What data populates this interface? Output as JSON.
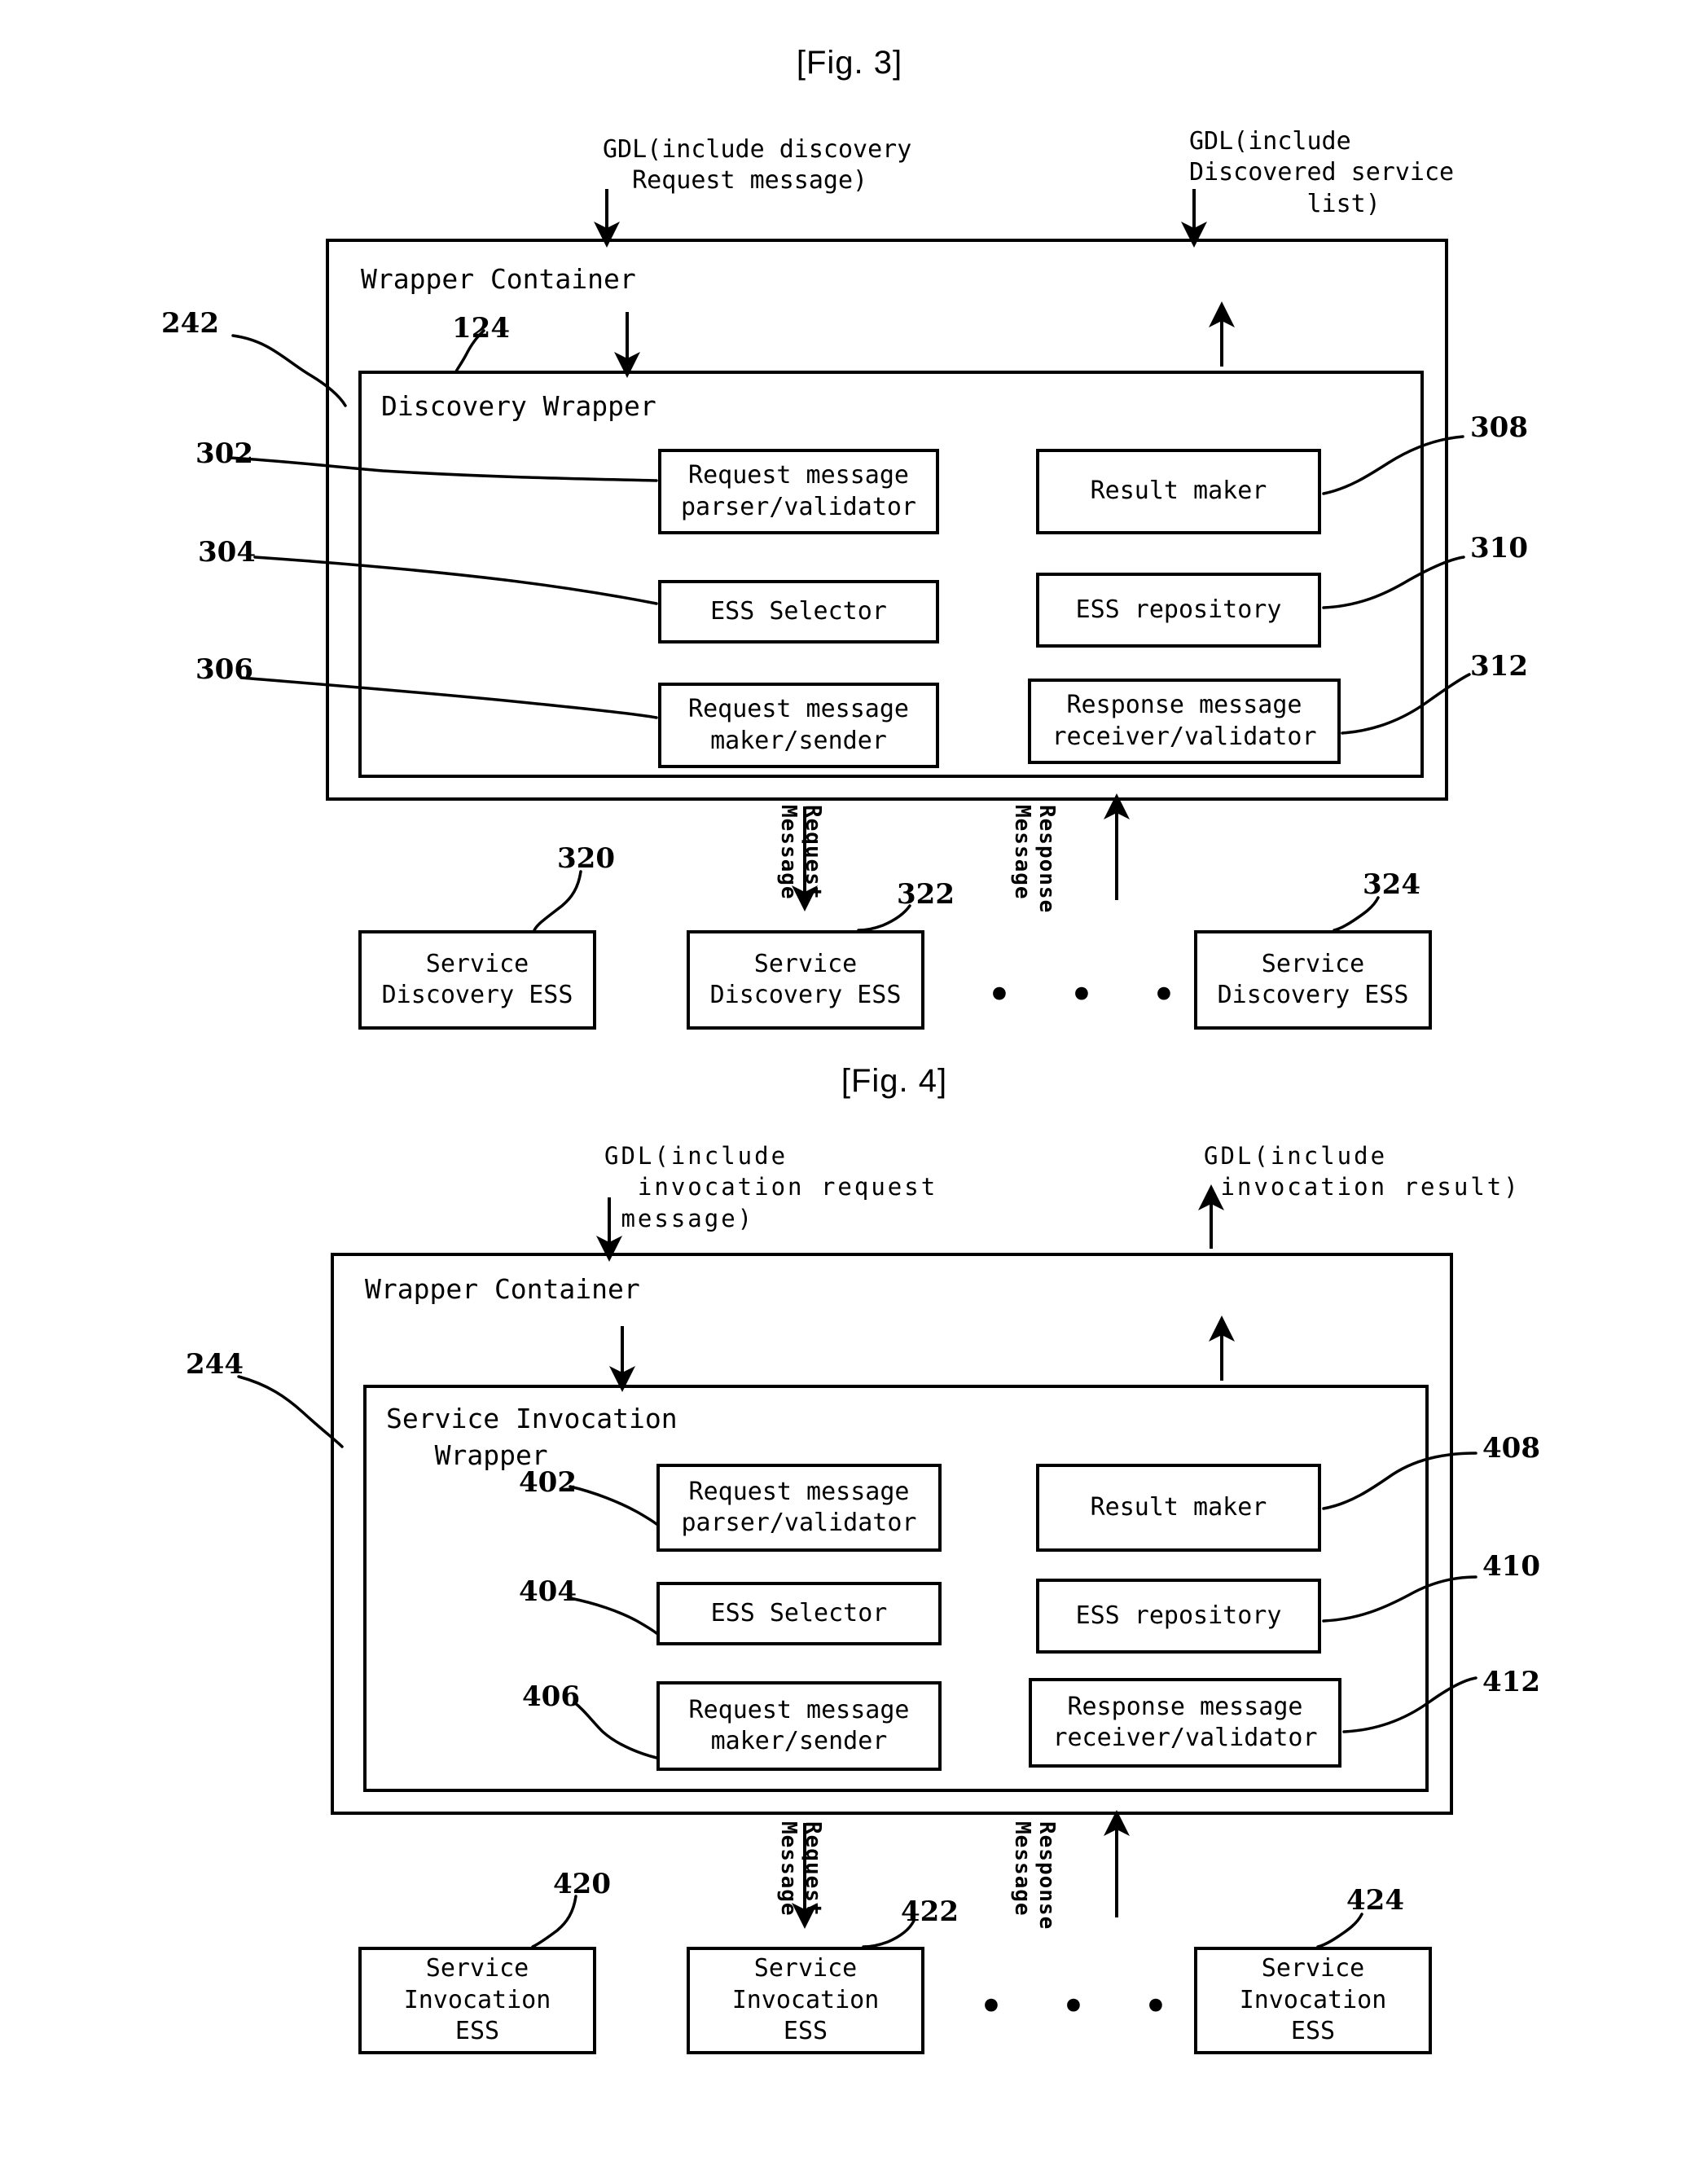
{
  "figures": [
    {
      "caption": "[Fig. 3]",
      "inputs": {
        "left_label": "GDL(include discovery\n  Request message)",
        "right_label": "GDL(include\nDiscovered service\n        list)"
      },
      "container": {
        "title": "Wrapper Container",
        "ref": "242"
      },
      "wrapper": {
        "title": "Discovery Wrapper",
        "ref": "124"
      },
      "units_left": [
        {
          "ref": "302",
          "label": "Request message\nparser/validator"
        },
        {
          "ref": "304",
          "label": "ESS Selector"
        },
        {
          "ref": "306",
          "label": "Request message\nmaker/sender"
        }
      ],
      "units_right": [
        {
          "ref": "308",
          "label": "Result maker"
        },
        {
          "ref": "310",
          "label": "ESS repository"
        },
        {
          "ref": "312",
          "label": "Response message\nreceiver/validator"
        }
      ],
      "flow_labels": {
        "request": "Request\nMessage",
        "response": "Response\nMessage"
      },
      "ess_nodes": [
        {
          "ref": "320",
          "label": "Service\nDiscovery ESS"
        },
        {
          "ref": "322",
          "label": "Service\nDiscovery ESS"
        },
        {
          "ref": "324",
          "label": "Service\nDiscovery ESS"
        }
      ],
      "ellipsis": "• • •"
    },
    {
      "caption": "[Fig. 4]",
      "inputs": {
        "left_label": "GDL(include\n  invocation request\n message)",
        "right_label": "GDL(include\n invocation result)"
      },
      "container": {
        "title": "Wrapper Container",
        "ref": "244"
      },
      "wrapper": {
        "title": "Service Invocation\n   Wrapper",
        "ref": ""
      },
      "units_left": [
        {
          "ref": "402",
          "label": "Request message\nparser/validator"
        },
        {
          "ref": "404",
          "label": "ESS Selector"
        },
        {
          "ref": "406",
          "label": "Request message\nmaker/sender"
        }
      ],
      "units_right": [
        {
          "ref": "408",
          "label": "Result maker"
        },
        {
          "ref": "410",
          "label": "ESS repository"
        },
        {
          "ref": "412",
          "label": "Response message\nreceiver/validator"
        }
      ],
      "flow_labels": {
        "request": "Request\nMessage",
        "response": "Response\nMessage"
      },
      "ess_nodes": [
        {
          "ref": "420",
          "label": "Service\nInvocation\nESS"
        },
        {
          "ref": "422",
          "label": "Service\nInvocation\nESS"
        },
        {
          "ref": "424",
          "label": "Service\nInvocation\nESS"
        }
      ],
      "ellipsis": "• • •"
    }
  ],
  "colors": {
    "ink": "#000000",
    "paper": "#ffffff"
  }
}
